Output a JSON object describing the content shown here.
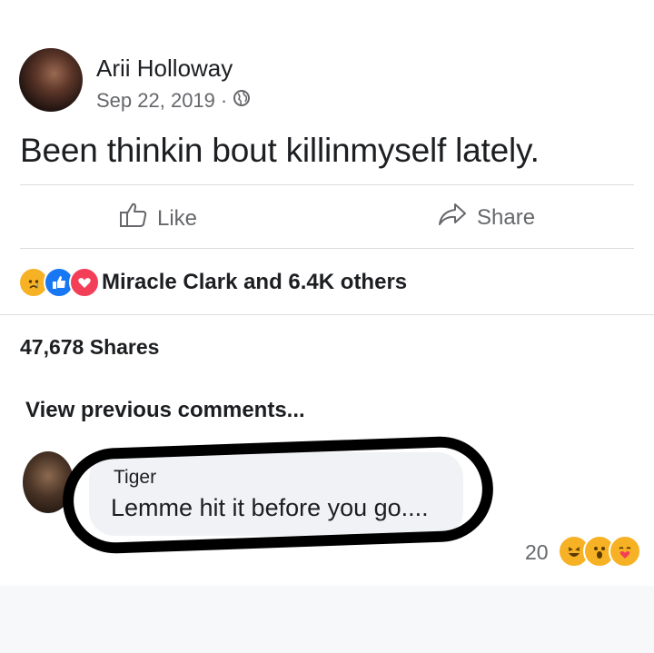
{
  "post": {
    "author": "Arii Holloway",
    "date": "Sep 22, 2019",
    "separator": "·",
    "privacy_icon": "globe-icon",
    "text": "Been thinkin bout killinmyself lately."
  },
  "actions": {
    "like_label": "Like",
    "share_label": "Share"
  },
  "reactions": {
    "icons": [
      "sad-reaction-icon",
      "like-reaction-icon",
      "love-reaction-icon"
    ],
    "summary": "Miracle Clark and 6.4K others"
  },
  "shares_text": "47,678 Shares",
  "comments": {
    "view_previous": "View previous comments...",
    "items": [
      {
        "author": "Tiger",
        "text": "Lemme hit it before you go....",
        "reaction_count": "20",
        "reaction_icons": [
          "haha-reaction-icon",
          "wow-reaction-icon",
          "care-reaction-icon"
        ]
      }
    ]
  },
  "colors": {
    "text_primary": "#1c1e21",
    "text_secondary": "#65676b",
    "divider": "#dadde1",
    "bubble": "#f0f2f5",
    "like_blue": "#1877f2",
    "love_red": "#f33e58",
    "emoji_yellow": "#f7b125"
  }
}
